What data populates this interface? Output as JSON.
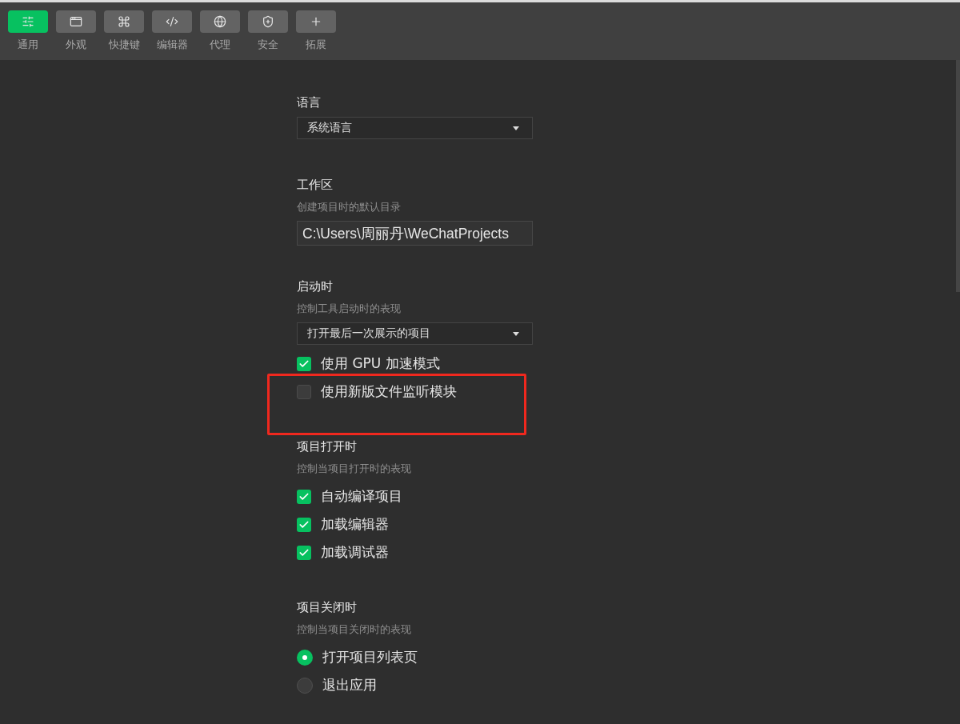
{
  "tabs": [
    {
      "label": "通用",
      "selected": true
    },
    {
      "label": "外观",
      "selected": false
    },
    {
      "label": "快捷键",
      "selected": false
    },
    {
      "label": "编辑器",
      "selected": false
    },
    {
      "label": "代理",
      "selected": false
    },
    {
      "label": "安全",
      "selected": false
    },
    {
      "label": "拓展",
      "selected": false
    }
  ],
  "sections": [
    {
      "title": "语言",
      "controls": [
        {
          "kind": "select",
          "value": "系统语言"
        }
      ]
    },
    {
      "title": "工作区",
      "description": "创建项目时的默认目录",
      "controls": [
        {
          "kind": "input",
          "value": "C:\\Users\\周丽丹\\WeChatProjects"
        }
      ]
    },
    {
      "title": "启动时",
      "description": "控制工具启动时的表现",
      "controls": [
        {
          "kind": "select",
          "value": "打开最后一次展示的项目"
        },
        {
          "kind": "checkbox",
          "label": "使用 GPU 加速模式",
          "checked": true,
          "highlighted": false
        },
        {
          "kind": "checkbox",
          "label": "使用新版文件监听模块",
          "checked": false,
          "highlighted": true
        }
      ]
    },
    {
      "title": "项目打开时",
      "description": "控制当项目打开时的表现",
      "controls": [
        {
          "kind": "checkbox",
          "label": "自动编译项目",
          "checked": true,
          "highlighted": false
        },
        {
          "kind": "checkbox",
          "label": "加载编辑器",
          "checked": true,
          "highlighted": false
        },
        {
          "kind": "checkbox",
          "label": "加载调试器",
          "checked": true,
          "highlighted": false
        }
      ]
    },
    {
      "title": "项目关闭时",
      "description": "控制当项目关闭时的表现",
      "controls": [
        {
          "kind": "radio",
          "label": "打开项目列表页",
          "selected": true
        },
        {
          "kind": "radio",
          "label": "退出应用",
          "selected": false
        }
      ]
    }
  ]
}
